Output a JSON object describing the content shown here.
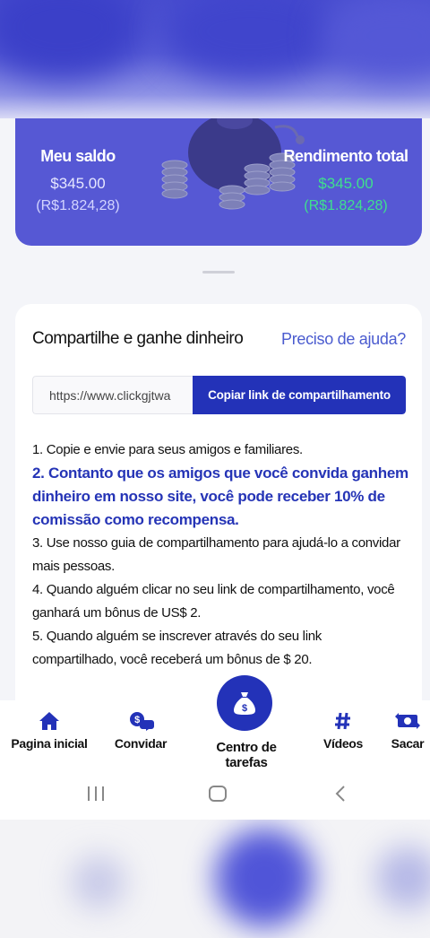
{
  "balance": {
    "my_balance_label": "Meu saldo",
    "my_balance_usd": "$345.00",
    "my_balance_brl": "(R$1.824,28)",
    "total_income_label": "Rendimento total",
    "total_income_usd": "$345.00",
    "total_income_brl": "(R$1.824,28)"
  },
  "share": {
    "title": "Compartilhe e ganhe dinheiro",
    "help_link": "Preciso de ajuda?",
    "link_value": "https://www.clickgjtwa",
    "copy_button": "Copiar link de compartilhamento",
    "steps": [
      "1. Copie e envie para seus amigos e familiares.",
      "2. Contanto que os amigos que você convida ganhem dinheiro em nosso site, você pode receber 10% de comissão como recompensa.",
      "3. Use nosso guia de compartilhamento para ajudá-lo a convidar mais pessoas.",
      "4. Quando alguém clicar no seu link de compartilhamento, você ganhará um bônus de US$ 2.",
      "5. Quando alguém se inscrever através do seu link compartilhado, você receberá um bônus de $ 20."
    ]
  },
  "nav": {
    "home": "Pagina inicial",
    "invite": "Convidar",
    "tasks": "Centro de tarefas",
    "videos": "Vídeos",
    "withdraw": "Sacar"
  },
  "colors": {
    "primary": "#2332b8",
    "card_purple": "#5658d4",
    "income_green": "#3fe08d",
    "link_blue": "#4a5bcf"
  }
}
